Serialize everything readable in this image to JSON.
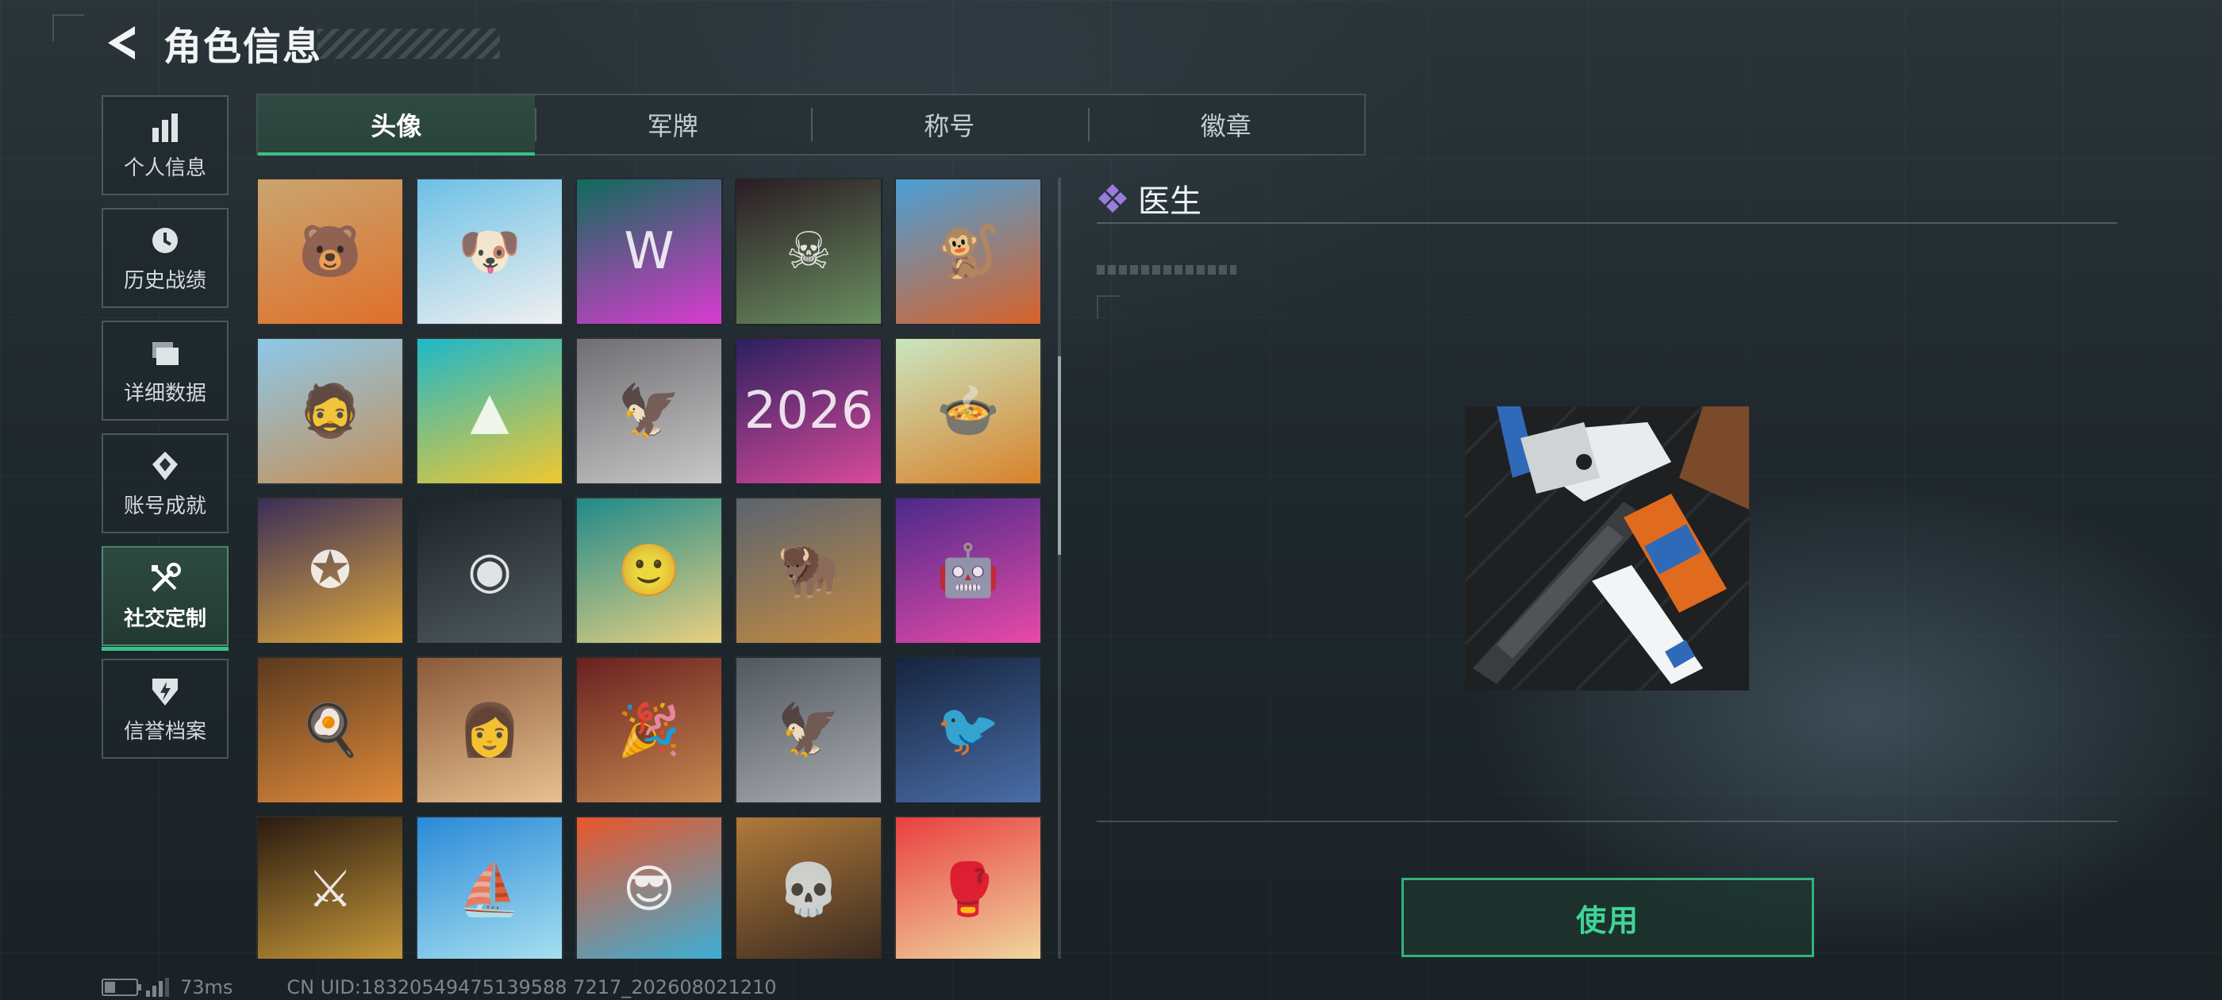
{
  "header": {
    "title": "角色信息"
  },
  "nav": {
    "items": [
      {
        "label": "个人信息",
        "icon": "bar-chart-icon"
      },
      {
        "label": "历史战绩",
        "icon": "history-clock-icon"
      },
      {
        "label": "详细数据",
        "icon": "folder-icon"
      },
      {
        "label": "账号成就",
        "icon": "achievement-icon"
      },
      {
        "label": "社交定制",
        "icon": "tools-icon",
        "active": true
      },
      {
        "label": "信誉档案",
        "icon": "credit-shield-icon"
      }
    ]
  },
  "tabs": [
    {
      "label": "头像",
      "active": true
    },
    {
      "label": "军牌"
    },
    {
      "label": "称号"
    },
    {
      "label": "徽章"
    }
  ],
  "avatars": [
    {
      "colors": [
        "#c8a570",
        "#e0702a"
      ],
      "glyph": "🐻"
    },
    {
      "colors": [
        "#6cc0e6",
        "#f0f0f0"
      ],
      "glyph": "🐶"
    },
    {
      "colors": [
        "#0f6b5a",
        "#d93bd1"
      ],
      "glyph": "W"
    },
    {
      "colors": [
        "#2a1c24",
        "#6a8f60"
      ],
      "glyph": "☠"
    },
    {
      "colors": [
        "#4aa0d8",
        "#d8622a"
      ],
      "glyph": "🐒"
    },
    {
      "colors": [
        "#8cc8ea",
        "#c69056"
      ],
      "glyph": "🧔"
    },
    {
      "colors": [
        "#1eb7c9",
        "#f0c830"
      ],
      "glyph": "▲"
    },
    {
      "colors": [
        "#6f6f73",
        "#c8c8c8"
      ],
      "glyph": "🦅"
    },
    {
      "colors": [
        "#2b2060",
        "#d84a9a"
      ],
      "glyph": "2026"
    },
    {
      "colors": [
        "#c9e6c0",
        "#d8822a"
      ],
      "glyph": "🍲"
    },
    {
      "colors": [
        "#3a2e58",
        "#e0a83a"
      ],
      "glyph": "✪"
    },
    {
      "colors": [
        "#1e2428",
        "#4f5a60"
      ],
      "glyph": "◉"
    },
    {
      "colors": [
        "#1f8a8a",
        "#e8d080"
      ],
      "glyph": "🙂"
    },
    {
      "colors": [
        "#5a6470",
        "#c48a40"
      ],
      "glyph": "🦬"
    },
    {
      "colors": [
        "#4a2a8a",
        "#e84aa8"
      ],
      "glyph": "🤖"
    },
    {
      "colors": [
        "#5a3a1e",
        "#e08a3a"
      ],
      "glyph": "🍳"
    },
    {
      "colors": [
        "#8a5a3a",
        "#e8c090"
      ],
      "glyph": "👩"
    },
    {
      "colors": [
        "#6a2020",
        "#c88a50"
      ],
      "glyph": "🎉"
    },
    {
      "colors": [
        "#525860",
        "#a8acb0"
      ],
      "glyph": "🦅"
    },
    {
      "colors": [
        "#16243e",
        "#4a6ea8"
      ],
      "glyph": "🐦"
    },
    {
      "colors": [
        "#2a1a10",
        "#c89a3a"
      ],
      "glyph": "⚔"
    },
    {
      "colors": [
        "#2a8ad8",
        "#a8e0f0"
      ],
      "glyph": "⛵"
    },
    {
      "colors": [
        "#e8562a",
        "#3ab0d8"
      ],
      "glyph": "😎"
    },
    {
      "colors": [
        "#b07a3a",
        "#3a2a20"
      ],
      "glyph": "💀"
    },
    {
      "colors": [
        "#e84040",
        "#f0d8a0"
      ],
      "glyph": "🥊"
    }
  ],
  "detail": {
    "name": "医生",
    "action_label": "使用"
  },
  "status": {
    "ping": "73ms",
    "uid": "CN UID:18320549475139588 7217_202608021210"
  },
  "colors": {
    "accent": "#39c08b",
    "rarity": "#9b7be0"
  }
}
